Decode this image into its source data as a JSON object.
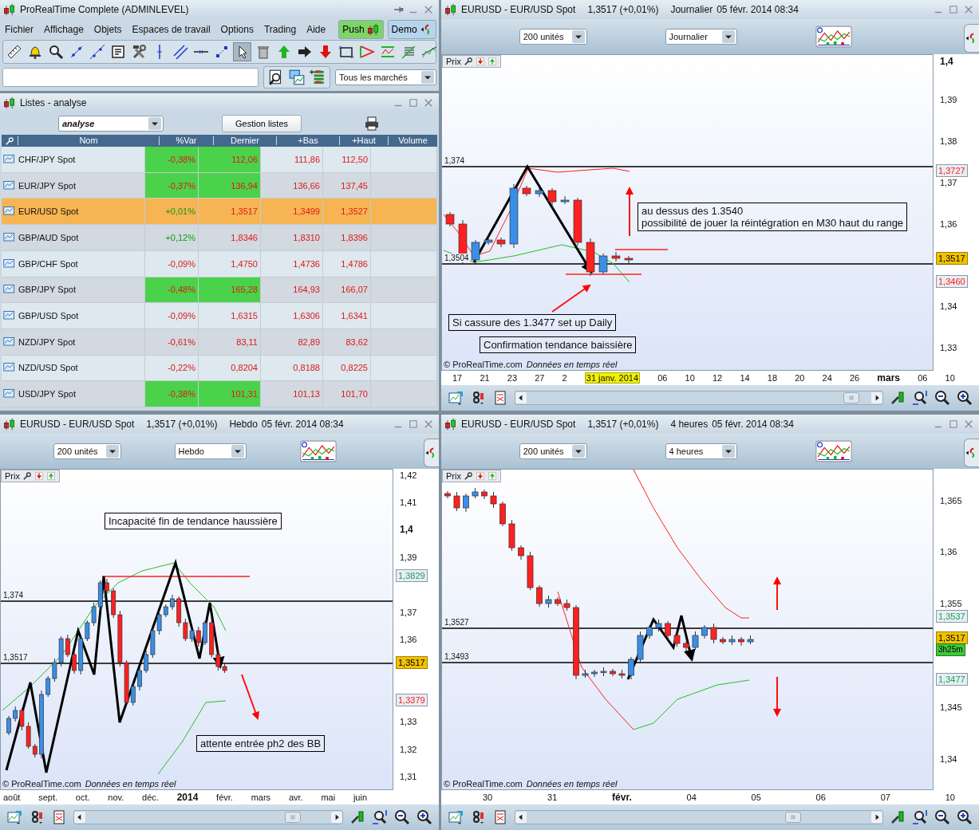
{
  "app_window": {
    "title": "ProRealTime Complete (ADMINLEVEL)",
    "menu": [
      "Fichier",
      "Affichage",
      "Objets",
      "Espaces de travail",
      "Options",
      "Trading",
      "Aide"
    ],
    "push_button": "Push",
    "demo_button": "Demo",
    "tools": [
      {
        "selected": false
      },
      {
        "selected": false
      },
      {
        "selected": false
      },
      {
        "selected": false
      },
      {
        "selected": false
      },
      {
        "selected": false
      },
      {
        "selected": false
      },
      {
        "selected": false
      },
      {
        "selected": false
      },
      {
        "selected": false
      },
      {
        "selected": false
      },
      {
        "selected": true
      },
      {
        "selected": false
      },
      {
        "selected": false
      },
      {
        "selected": false
      },
      {
        "selected": false
      },
      {
        "selected": false
      },
      {
        "selected": false
      },
      {
        "selected": false
      },
      {
        "selected": false
      },
      {
        "selected": false
      }
    ],
    "market_filter": "Tous les marchés"
  },
  "list_panel": {
    "title": "Listes - analyse",
    "list_select": "analyse",
    "manage_button": "Gestion listes",
    "columns": [
      "Nom",
      "%Var",
      "Dernier",
      "+Bas",
      "+Haut",
      "Volume"
    ],
    "rows": [
      {
        "name": "CHF/JPY Spot",
        "var": "-0,38%",
        "last": "112,06",
        "low": "111,86",
        "high": "112,50",
        "kind": "loss",
        "highlight": true,
        "selected": false
      },
      {
        "name": "EUR/JPY Spot",
        "var": "-0,37%",
        "last": "136,94",
        "low": "136,66",
        "high": "137,45",
        "kind": "loss",
        "highlight": true,
        "selected": false
      },
      {
        "name": "EUR/USD Spot",
        "var": "+0,01%",
        "last": "1,3517",
        "low": "1,3499",
        "high": "1,3527",
        "kind": "gain",
        "highlight": false,
        "selected": true
      },
      {
        "name": "GBP/AUD Spot",
        "var": "+0,12%",
        "last": "1,8346",
        "low": "1,8310",
        "high": "1,8396",
        "kind": "gain",
        "highlight": false,
        "selected": false
      },
      {
        "name": "GBP/CHF Spot",
        "var": "-0,09%",
        "last": "1,4750",
        "low": "1,4736",
        "high": "1,4786",
        "kind": "loss",
        "highlight": false,
        "selected": false
      },
      {
        "name": "GBP/JPY Spot",
        "var": "-0,48%",
        "last": "165,28",
        "low": "164,93",
        "high": "166,07",
        "kind": "loss",
        "highlight": true,
        "selected": false
      },
      {
        "name": "GBP/USD Spot",
        "var": "-0,09%",
        "last": "1,6315",
        "low": "1,6306",
        "high": "1,6341",
        "kind": "loss",
        "highlight": false,
        "selected": false
      },
      {
        "name": "NZD/JPY Spot",
        "var": "-0,61%",
        "last": "83,11",
        "low": "82,89",
        "high": "83,62",
        "kind": "loss",
        "highlight": false,
        "selected": false
      },
      {
        "name": "NZD/USD Spot",
        "var": "-0,22%",
        "last": "0,8204",
        "low": "0,8188",
        "high": "0,8225",
        "kind": "loss",
        "highlight": false,
        "selected": false
      },
      {
        "name": "USD/JPY Spot",
        "var": "-0,38%",
        "last": "101,31",
        "low": "101,13",
        "high": "101,70",
        "kind": "loss",
        "highlight": true,
        "selected": false
      }
    ]
  },
  "charts": [
    {
      "symbol": "EURUSD - EUR/USD Spot",
      "quote": "1,3517 (+0,01%)",
      "period": "Journalier",
      "timestamp": "05 févr. 2014 08:34",
      "units_select": "200 unités",
      "period_select": "Journalier",
      "price_label": "Prix",
      "y_ticks": [
        {
          "label": "1,4",
          "kind": "major"
        },
        {
          "label": "1,39",
          "kind": "plain"
        },
        {
          "label": "1,38",
          "kind": "plain"
        },
        {
          "label": "1,37",
          "kind": "plain"
        },
        {
          "label": "1,36",
          "kind": "plain"
        },
        {
          "label": "1,34",
          "kind": "plain"
        },
        {
          "label": "1,33",
          "kind": "plain"
        }
      ],
      "badges": [
        {
          "text": "1,3727",
          "kind": "band",
          "color": "#ff1a1a"
        },
        {
          "text": "1,3517",
          "kind": "price"
        },
        {
          "text": "1,3460",
          "kind": "band",
          "color": "#ff1a1a"
        }
      ],
      "levels": [
        "1,374",
        "1,3504"
      ],
      "notes": [
        "au dessus des 1.3540\npossibilité de jouer la réintégration en M30 haut du range",
        "Si cassure des 1.3477 set up Daily",
        "Confirmation tendance baissière"
      ],
      "copyright": "© ProRealTime.com",
      "data_note": "Données en temps réel",
      "x_labels": [
        {
          "label": "17",
          "kind": "plain"
        },
        {
          "label": "21",
          "kind": "plain"
        },
        {
          "label": "23",
          "kind": "plain"
        },
        {
          "label": "27",
          "kind": "plain"
        },
        {
          "label": "2",
          "kind": "plain"
        },
        {
          "label": "31 janv. 2014",
          "kind": "highlight"
        },
        {
          "label": "06",
          "kind": "plain"
        },
        {
          "label": "10",
          "kind": "plain"
        },
        {
          "label": "12",
          "kind": "plain"
        },
        {
          "label": "14",
          "kind": "plain"
        },
        {
          "label": "18",
          "kind": "plain"
        },
        {
          "label": "20",
          "kind": "plain"
        },
        {
          "label": "24",
          "kind": "plain"
        },
        {
          "label": "26",
          "kind": "plain"
        },
        {
          "label": "mars",
          "kind": "major"
        },
        {
          "label": "06",
          "kind": "plain"
        },
        {
          "label": "10",
          "kind": "plain"
        }
      ]
    },
    {
      "symbol": "EURUSD - EUR/USD Spot",
      "quote": "1,3517 (+0,01%)",
      "period": "Hebdo",
      "timestamp": "05 févr. 2014 08:34",
      "units_select": "200 unités",
      "period_select": "Hebdo",
      "price_label": "Prix",
      "y_ticks": [
        {
          "label": "1,42",
          "kind": "plain"
        },
        {
          "label": "1,41",
          "kind": "plain"
        },
        {
          "label": "1,4",
          "kind": "major"
        },
        {
          "label": "1,39",
          "kind": "plain"
        },
        {
          "label": "1,37",
          "kind": "plain"
        },
        {
          "label": "1,36",
          "kind": "plain"
        },
        {
          "label": "1,33",
          "kind": "plain"
        },
        {
          "label": "1,32",
          "kind": "plain"
        },
        {
          "label": "1,31",
          "kind": "plain"
        }
      ],
      "badges": [
        {
          "text": "1,3829",
          "kind": "band",
          "color": "#1aa05a"
        },
        {
          "text": "1,3517",
          "kind": "price"
        },
        {
          "text": "1,3379",
          "kind": "band",
          "color": "#ff1a1a"
        }
      ],
      "levels": [
        "1,374",
        "1,3517"
      ],
      "notes": [
        "Incapacité fin de tendance haussière",
        "attente entrée ph2 des BB"
      ],
      "copyright": "© ProRealTime.com",
      "data_note": "Données en temps réel",
      "x_labels": [
        {
          "label": "août",
          "kind": "plain"
        },
        {
          "label": "sept.",
          "kind": "plain"
        },
        {
          "label": "oct.",
          "kind": "plain"
        },
        {
          "label": "nov.",
          "kind": "plain"
        },
        {
          "label": "déc.",
          "kind": "plain"
        },
        {
          "label": "2014",
          "kind": "major"
        },
        {
          "label": "févr.",
          "kind": "plain"
        },
        {
          "label": "mars",
          "kind": "plain"
        },
        {
          "label": "avr.",
          "kind": "plain"
        },
        {
          "label": "mai",
          "kind": "plain"
        },
        {
          "label": "juin",
          "kind": "plain"
        }
      ]
    },
    {
      "symbol": "EURUSD - EUR/USD Spot",
      "quote": "1,3517 (+0,01%)",
      "period": "4 heures",
      "timestamp": "05 févr. 2014 08:34",
      "units_select": "200 unités",
      "period_select": "4 heures",
      "price_label": "Prix",
      "y_ticks": [
        {
          "label": "1,365",
          "kind": "plain"
        },
        {
          "label": "1,36",
          "kind": "plain"
        },
        {
          "label": "1,355",
          "kind": "plain"
        },
        {
          "label": "1,345",
          "kind": "plain"
        },
        {
          "label": "1,34",
          "kind": "plain"
        }
      ],
      "badges": [
        {
          "text": "1,3537",
          "kind": "band",
          "color": "#1aa05a"
        },
        {
          "text": "1,3517",
          "kind": "price"
        },
        {
          "text": "3h25m",
          "kind": "timer"
        },
        {
          "text": "1,3477",
          "kind": "band",
          "color": "#1aa05a"
        }
      ],
      "levels": [
        "1,3527",
        "1,3493"
      ],
      "copyright": "© ProRealTime.com",
      "data_note": "Données en temps réel",
      "x_labels": [
        {
          "label": "30",
          "kind": "plain"
        },
        {
          "label": "31",
          "kind": "plain"
        },
        {
          "label": "févr.",
          "kind": "major"
        },
        {
          "label": "04",
          "kind": "plain"
        },
        {
          "label": "05",
          "kind": "plain"
        },
        {
          "label": "06",
          "kind": "plain"
        },
        {
          "label": "07",
          "kind": "plain"
        },
        {
          "label": "10",
          "kind": "plain"
        }
      ]
    }
  ]
}
